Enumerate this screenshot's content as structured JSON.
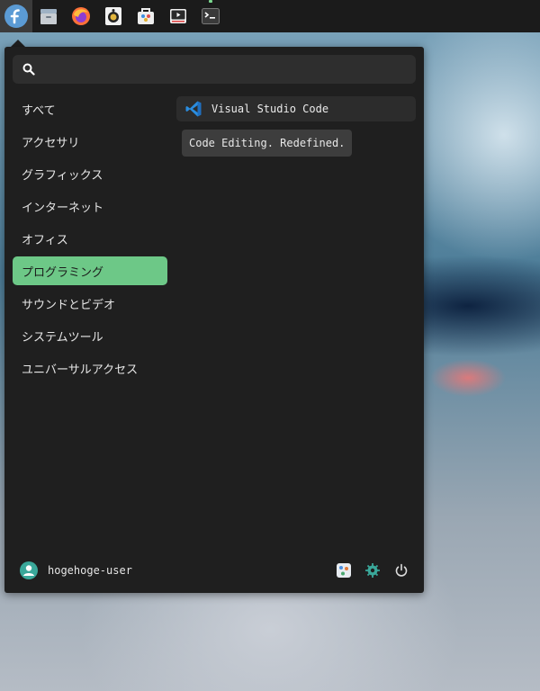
{
  "taskbar": {
    "items": [
      {
        "name": "fedora-logo-icon"
      },
      {
        "name": "files-icon"
      },
      {
        "name": "firefox-icon"
      },
      {
        "name": "rhythmbox-icon"
      },
      {
        "name": "software-icon"
      },
      {
        "name": "videos-icon"
      },
      {
        "name": "terminal-icon"
      }
    ]
  },
  "menu": {
    "search": {
      "value": "",
      "placeholder": ""
    },
    "categories": [
      {
        "label": "すべて"
      },
      {
        "label": "アクセサリ"
      },
      {
        "label": "グラフィックス"
      },
      {
        "label": "インターネット"
      },
      {
        "label": "オフィス"
      },
      {
        "label": "プログラミング"
      },
      {
        "label": "サウンドとビデオ"
      },
      {
        "label": "システムツール"
      },
      {
        "label": "ユニバーサルアクセス"
      }
    ],
    "selected_category": "プログラミング",
    "apps": [
      {
        "label": "Visual Studio Code",
        "icon": "vscode-icon",
        "tooltip": "Code Editing. Redefined."
      }
    ],
    "footer": {
      "username": "hogehoge-user",
      "buttons": [
        {
          "icon": "settings-icon"
        },
        {
          "icon": "lock-screen-icon"
        },
        {
          "icon": "power-icon"
        }
      ]
    }
  },
  "colors": {
    "accent": "#6dc887",
    "panel": "#1f1f1f",
    "taskbar": "#1b1b1b"
  }
}
